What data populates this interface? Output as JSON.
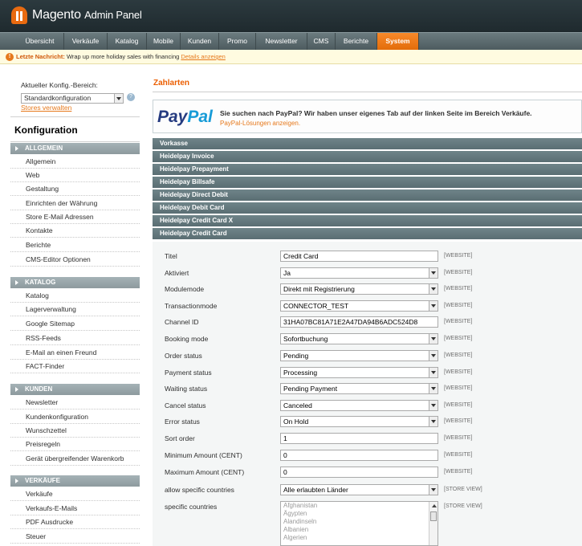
{
  "header": {
    "brand": "Magento",
    "brand_sub": "Admin Panel"
  },
  "nav": [
    {
      "label": "Übersicht",
      "active": false
    },
    {
      "label": "Verkäufe",
      "active": false
    },
    {
      "label": "Katalog",
      "active": false
    },
    {
      "label": "Mobile",
      "active": false
    },
    {
      "label": "Kunden",
      "active": false
    },
    {
      "label": "Promo",
      "active": false
    },
    {
      "label": "Newsletter",
      "active": false
    },
    {
      "label": "CMS",
      "active": false
    },
    {
      "label": "Berichte",
      "active": false
    },
    {
      "label": "System",
      "active": true
    }
  ],
  "notice": {
    "prefix": "Letzte Nachricht:",
    "message": "Wrap up more holiday sales with financing",
    "link": "Details anzeigen"
  },
  "sidebar": {
    "scope_label": "Aktueller Konfig.-Bereich:",
    "scope_value": "Standardkonfiguration",
    "stores_link": "Stores verwalten",
    "title": "Konfiguration",
    "groups": [
      {
        "title": "ALLGEMEIN",
        "items": [
          "Allgemein",
          "Web",
          "Gestaltung",
          "Einrichten der Währung",
          "Store E-Mail Adressen",
          "Kontakte",
          "Berichte",
          "CMS-Editor Optionen"
        ]
      },
      {
        "title": "KATALOG",
        "items": [
          "Katalog",
          "Lagerverwaltung",
          "Google Sitemap",
          "RSS-Feeds",
          "E-Mail an einen Freund",
          "FACT-Finder"
        ]
      },
      {
        "title": "KUNDEN",
        "items": [
          "Newsletter",
          "Kundenkonfiguration",
          "Wunschzettel",
          "Preisregeln",
          "Gerät übergreifender Warenkorb"
        ]
      },
      {
        "title": "VERKÄUFE",
        "items": [
          "Verkäufe",
          "Verkaufs-E-Mails",
          "PDF Ausdrucke",
          "Steuer"
        ]
      }
    ]
  },
  "main": {
    "title": "Zahlarten",
    "paypal": {
      "logo_pay": "Pay",
      "logo_pal": "Pal",
      "text": "Sie suchen nach PayPal? Wir haben unser eigenes Tab auf der linken Seite im Bereich Verkäufe.",
      "link": "PayPal-Lösungen anzeigen."
    },
    "sections": [
      "Vorkasse",
      "Heidelpay Invoice",
      "Heidelpay Prepayment",
      "Heidelpay Billsafe",
      "Heidelpay Direct Debit",
      "Heidelpay Debit Card",
      "Heidelpay Credit Card X",
      "Heidelpay Credit Card"
    ],
    "fields": [
      {
        "label": "Titel",
        "value": "Credit Card",
        "type": "text",
        "scope": "[WEBSITE]"
      },
      {
        "label": "Aktiviert",
        "value": "Ja",
        "type": "select",
        "scope": "[WEBSITE]"
      },
      {
        "label": "Modulemode",
        "value": "Direkt mit Registrierung",
        "type": "select",
        "scope": "[WEBSITE]"
      },
      {
        "label": "Transactionmode",
        "value": "CONNECTOR_TEST",
        "type": "select",
        "scope": "[WEBSITE]"
      },
      {
        "label": "Channel ID",
        "value": "31HA07BC81A71E2A47DA94B6ADC524D8",
        "type": "text",
        "scope": "[WEBSITE]"
      },
      {
        "label": "Booking mode",
        "value": "Sofortbuchung",
        "type": "select",
        "scope": "[WEBSITE]"
      },
      {
        "label": "Order status",
        "value": "Pending",
        "type": "select",
        "scope": "[WEBSITE]"
      },
      {
        "label": "Payment status",
        "value": "Processing",
        "type": "select",
        "scope": "[WEBSITE]"
      },
      {
        "label": "Waiting status",
        "value": "Pending Payment",
        "type": "select",
        "scope": "[WEBSITE]"
      },
      {
        "label": "Cancel status",
        "value": "Canceled",
        "type": "select",
        "scope": "[WEBSITE]"
      },
      {
        "label": "Error status",
        "value": "On Hold",
        "type": "select",
        "scope": "[WEBSITE]"
      },
      {
        "label": "Sort order",
        "value": "1",
        "type": "text",
        "scope": "[WEBSITE]"
      },
      {
        "label": "Minimum Amount (CENT)",
        "value": "0",
        "type": "text",
        "scope": "[WEBSITE]"
      },
      {
        "label": "Maximum Amount (CENT)",
        "value": "0",
        "type": "text",
        "scope": "[WEBSITE]"
      },
      {
        "label": "allow specific countries",
        "value": "Alle erlaubten Länder",
        "type": "select",
        "scope": "[STORE VIEW]"
      }
    ],
    "countries": {
      "label": "specific countries",
      "scope": "[STORE VIEW]",
      "options": [
        "Afghanistan",
        "Ägypten",
        "Alandinseln",
        "Albanien",
        "Algerien"
      ]
    }
  }
}
